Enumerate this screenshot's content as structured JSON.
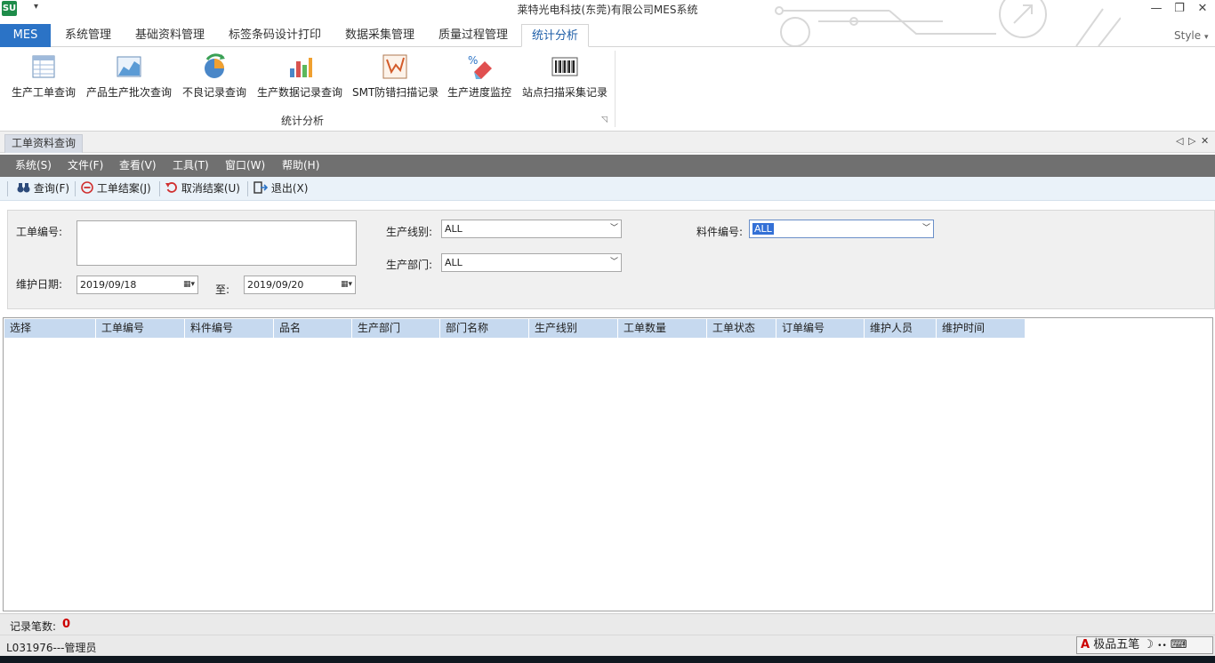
{
  "window": {
    "title": "莱特光电科技(东莞)有限公司MES系统",
    "app_icon_text": "SU",
    "qa_arrow": "▾",
    "minimize": "—",
    "restore": "❐",
    "close": "✕"
  },
  "ribbon": {
    "tabs": [
      "MES",
      "系统管理",
      "基础资料管理",
      "标签条码设计打印",
      "数据采集管理",
      "质量过程管理",
      "统计分析"
    ],
    "style_label": "Style",
    "style_arrow": "▾",
    "buttons": [
      "生产工单查询",
      "产品生产批次查询",
      "不良记录查询",
      "生产数据记录查询",
      "SMT防错扫描记录",
      "生产进度监控",
      "站点扫描采集记录"
    ],
    "group_label": "统计分析",
    "group_launcher": "◹"
  },
  "doc": {
    "tab": "工单资料查询",
    "prev": "◁",
    "next": "▷",
    "close": "✕"
  },
  "menu": [
    "系统(S)",
    "文件(F)",
    "查看(V)",
    "工具(T)",
    "窗口(W)",
    "帮助(H)"
  ],
  "toolbar": [
    "查询(F)",
    "工单结案(J)",
    "取消结案(U)",
    "退出(X)"
  ],
  "form": {
    "workorder_label": "工单编号:",
    "workorder_value": "",
    "line_label": "生产线别:",
    "line_value": "ALL",
    "part_label": "料件编号:",
    "part_value": "ALL",
    "dept_label": "生产部门:",
    "dept_value": "ALL",
    "date_label": "维护日期:",
    "date_from": "2019/09/18",
    "to_label": "至:",
    "date_to": "2019/09/20"
  },
  "grid": {
    "columns": [
      "选择",
      "工单编号",
      "料件编号",
      "品名",
      "生产部门",
      "部门名称",
      "生产线别",
      "工单数量",
      "工单状态",
      "订单编号",
      "维护人员",
      "维护时间"
    ]
  },
  "status": {
    "count_label": "记录笔数:",
    "count_value": "0",
    "user": "L031976---管理员"
  },
  "ime": {
    "glyph": "A",
    "label": "极品五笔",
    "moon": "☽",
    "dots": "••",
    "keyboard": "⌨"
  },
  "colors": {
    "accent": "#2b73c6",
    "menubar": "#707070",
    "grid_header": "#c6d9ef",
    "count": "#cc0000"
  }
}
